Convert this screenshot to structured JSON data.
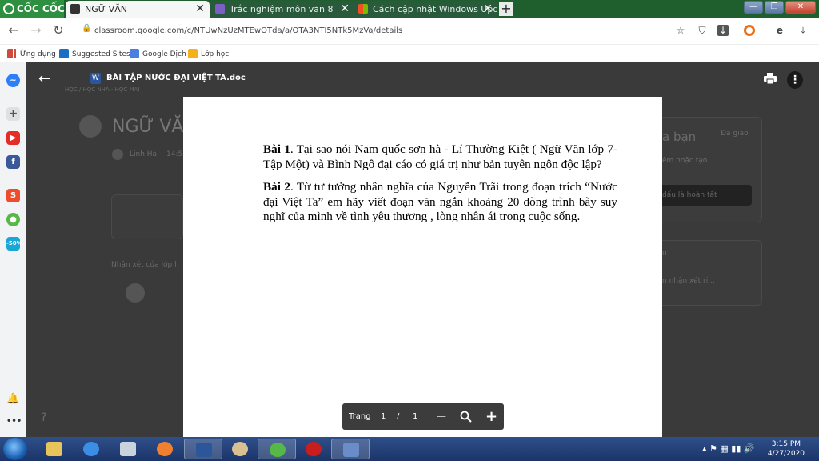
{
  "browser": {
    "brand": "CỐC CỐC",
    "tabs": [
      {
        "label": "NGỮ VĂN",
        "active": true
      },
      {
        "label": "Trắc nghiệm môn văn 8",
        "active": false
      },
      {
        "label": "Cách cập nhật Windows Upd",
        "active": false
      }
    ],
    "new_tab": "+",
    "url": "classroom.google.com/c/NTUwNzUzMTEwOTda/a/OTA3NTI5NTk5MzVa/details",
    "bookmarks": [
      "Ứng dụng",
      "Suggested Sites",
      "Google Dịch",
      "Lớp học"
    ]
  },
  "background": {
    "course_title": "NGỮ VĂ",
    "subtitle": "HỌC / HỌC NHÀ - HỌC MÃI",
    "author": "Linh Hà",
    "time": "14:5",
    "comment_label": "Nhận xét của lớp h",
    "panel_title": "a bạn",
    "panel_status": "Đã giao",
    "panel_add": "êm hoặc tạo",
    "panel_button": "dấu là hoàn tất",
    "panel2_label": "u",
    "panel2_input": "n nhận xét ri..."
  },
  "viewer": {
    "file_name": "BÀI TẬP NƯỚC ĐẠI VIỆT TA.doc",
    "file_icon": "W",
    "doc": {
      "q1_label": "Bài 1",
      "q1_text": ". Tại sao nói Nam quốc sơn hà - Lí Thường Kiệt ( Ngữ Văn lớp 7- Tập Một)  và Bình Ngô đại cáo có giá trị như bản tuyên ngôn độc lập?",
      "q2_label": "Bài 2",
      "q2_text": ".  Từ tư tưởng nhân nghĩa của Nguyễn Trãi trong đoạn trích “Nước đại Việt Ta” em hãy viết đoạn văn ngắn khoảng 20 dòng trình bày suy nghĩ của mình về tình yêu thương , lòng nhân ái trong cuộc sống."
    },
    "pager": {
      "label": "Trang",
      "current": "1",
      "sep": "/",
      "total": "1",
      "zoom_out": "—",
      "zoom_in": "+"
    }
  },
  "taskbar": {
    "time": "3:15 PM",
    "date": "4/27/2020"
  }
}
